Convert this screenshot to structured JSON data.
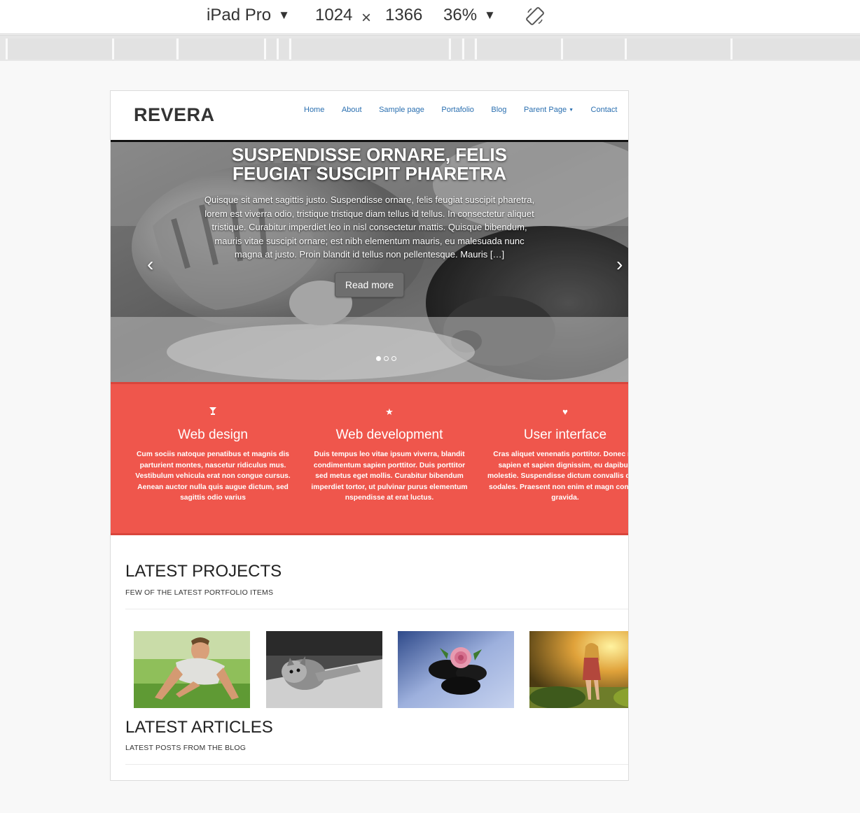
{
  "devtools": {
    "device": "iPad Pro",
    "width": "1024",
    "times": "×",
    "height": "1366",
    "zoom": "36%"
  },
  "site": {
    "logo": "REVERA",
    "nav": [
      "Home",
      "About",
      "Sample page",
      "Portafolio",
      "Blog",
      "Parent Page",
      "Contact"
    ]
  },
  "slider": {
    "title": "SUSPENDISSE ORNARE, FELIS FEUGIAT SUSCIPIT PHARETRA",
    "text": "Quisque sit amet sagittis justo. Suspendisse ornare, felis feugiat suscipit pharetra, lorem est viverra odio, tristique tristique diam tellus id tellus. In consectetur aliquet tristique. Curabitur imperdiet leo in nisl consectetur mattis. Quisque bibendum, mauris vitae suscipit ornare; est nibh elementum mauris, eu malesuada nunc magna at justo. Proin blandit id tellus non pellentesque. Mauris […]",
    "button": "Read more",
    "prev": "‹",
    "next": "›"
  },
  "services": [
    {
      "icon": "glass-icon",
      "title": "Web design",
      "text": "Cum sociis natoque penatibus et magnis dis parturient montes, nascetur ridiculus mus. Vestibulum vehicula erat non congue cursus. Aenean auctor nulla quis augue dictum, sed sagittis odio varius"
    },
    {
      "icon": "star-icon",
      "title": "Web development",
      "text": "Duis tempus leo vitae ipsum viverra, blandit condimentum sapien porttitor. Duis porttitor sed metus eget mollis. Curabitur bibendum imperdiet tortor, ut pulvinar purus elementum nspendisse at erat luctus."
    },
    {
      "icon": "heart-icon",
      "title": "User interface",
      "text": "Cras aliquet venenatis porttitor. Donec rut sapien et sapien dignissim, eu dapibus molestie. Suspendisse dictum convallis qu et sodales. Praesent non enim et magn congue gravida."
    }
  ],
  "projects": {
    "title": "LATEST PROJECTS",
    "subtitle": "FEW OF THE LATEST PORTFOLIO ITEMS"
  },
  "articles": {
    "title": "LATEST ARTICLES",
    "subtitle": "LATEST POSTS FROM THE BLOG"
  }
}
